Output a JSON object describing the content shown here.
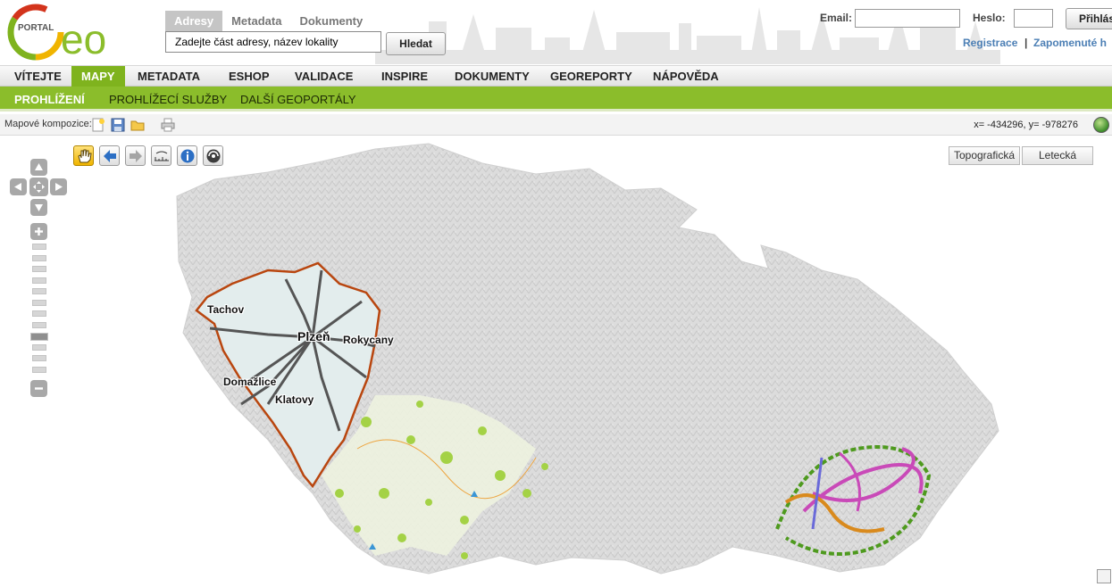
{
  "header": {
    "logo_text": "PORTAL GEO",
    "search_tabs": [
      "Adresy",
      "Metadata",
      "Dokumenty"
    ],
    "search_placeholder": "Zadejte část adresy, název lokality",
    "search_button": "Hledat",
    "email_label": "Email:",
    "password_label": "Heslo:",
    "login_button": "Přihlás",
    "register_link": "Registrace",
    "link_separator": "|",
    "forgot_link": "Zapomenuté h"
  },
  "main_nav": [
    "VÍTEJTE",
    "MAPY",
    "METADATA",
    "ESHOP",
    "VALIDACE",
    "INSPIRE",
    "DOKUMENTY",
    "GEOREPORTY",
    "NÁPOVĚDA"
  ],
  "main_nav_active": "MAPY",
  "sub_nav": [
    "PROHLÍŽENÍ",
    "PROHLÍŽECÍ SLUŽBY",
    "DALŠÍ GEOPORTÁLY"
  ],
  "sub_nav_active": "PROHLÍŽENÍ",
  "toolbar": {
    "compositions_label": "Mapové kompozice:",
    "icons": [
      "new-composition-icon",
      "save-icon",
      "open-folder-icon",
      "print-icon"
    ],
    "coordinates": "x= -434296, y= -978276"
  },
  "map": {
    "tools": [
      "pan-hand-icon",
      "back-arrow-icon",
      "forward-arrow-icon",
      "measure-icon",
      "info-icon",
      "globe-tool-icon"
    ],
    "basemap_buttons": [
      "Topografická",
      "Letecká"
    ],
    "labels": {
      "tachov": "Tachov",
      "rokycany": "Rokycany",
      "plzen": "Plzeň",
      "domazlice": "Domažlice",
      "klatovy": "Klatovy"
    },
    "zoom_level_index": 8,
    "zoom_levels": 12,
    "colors": {
      "terrain": "#d9d9d9",
      "plzen_region_fill": "#e3eded",
      "plzen_region_border": "#b9460f",
      "roads": "#555555",
      "vegetation": "#9fd236",
      "zlin_green": "#4e9a1e",
      "zlin_magenta": "#c94ab8",
      "zlin_orange": "#d98a1d"
    }
  }
}
